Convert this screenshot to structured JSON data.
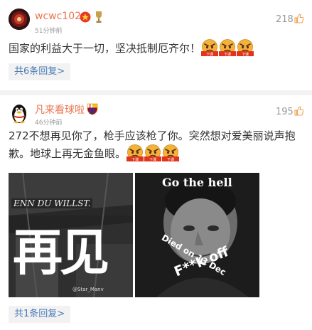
{
  "comments": [
    {
      "username": "wcwc102",
      "time": "51分钟前",
      "likes": "218",
      "text": "国家的利益大于一切，坚决抵制厄齐尔！",
      "emoji_label": "下课",
      "replies": "共6条回复",
      "icons": [
        "avatar",
        "medal-icon",
        "trophy-icon",
        "thumbs-up-icon",
        "angry-face-icon"
      ]
    },
    {
      "username": "凡来看球啦",
      "time": "46分钟前",
      "likes": "195",
      "text_line1": "272不想再见你了，枪手应该枪了你。突然想对爱美丽说声抱",
      "text_line2": "歉。地球上再无金鱼眼。",
      "emoji_label": "下课",
      "replies": "共1条回复",
      "image_left": {
        "banner": "ENN DU WILLST.",
        "big_text": "再见",
        "watermark": "@Star_Manv"
      },
      "image_right": {
        "top_text": "Go the hell",
        "diagonal_text": "Died on 13 Dec",
        "bottom_text": "F**k off"
      },
      "icons": [
        "qq-penguin-avatar",
        "fc-barcelona-icon",
        "thumbs-up-icon",
        "angry-face-icon"
      ]
    }
  ],
  "colors": {
    "username": "#eb7350",
    "reply_link": "#4a7bb7",
    "divider": "#f2f2f2",
    "muted": "#999999"
  }
}
